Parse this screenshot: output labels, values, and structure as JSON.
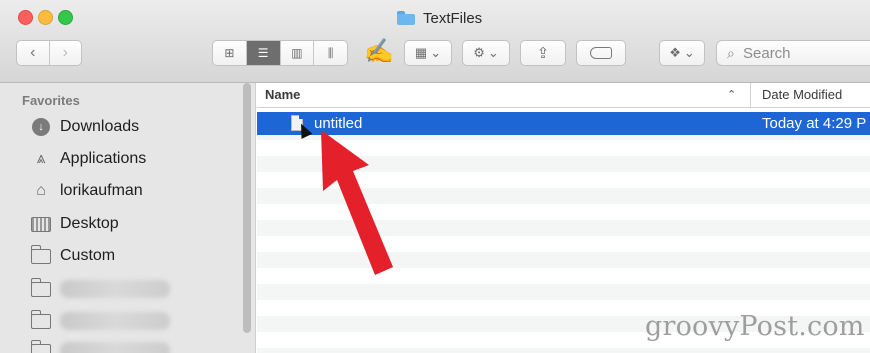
{
  "window": {
    "title": "TextFiles"
  },
  "toolbar": {
    "back_icon": "chevron-left-icon",
    "forward_icon": "chevron-right-icon",
    "views": [
      "icon-view",
      "list-view",
      "column-view",
      "cover-flow-view"
    ],
    "active_view": "list-view",
    "search_placeholder": "Search"
  },
  "sidebar": {
    "section_title": "Favorites",
    "items": [
      {
        "label": "Downloads",
        "icon": "download-icon"
      },
      {
        "label": "Applications",
        "icon": "applications-icon"
      },
      {
        "label": "lorikaufman",
        "icon": "home-icon"
      },
      {
        "label": "Desktop",
        "icon": "desktop-icon"
      },
      {
        "label": "Custom",
        "icon": "folder-icon"
      }
    ]
  },
  "files": {
    "columns": {
      "name": "Name",
      "date": "Date Modified"
    },
    "rows": [
      {
        "name": "untitled",
        "date": "Today at 4:29 P",
        "selected": true
      }
    ]
  },
  "annotation": {
    "color": "#e4202a"
  },
  "watermark": "groovyPost.com",
  "colors": {
    "selection": "#1d66d6"
  }
}
